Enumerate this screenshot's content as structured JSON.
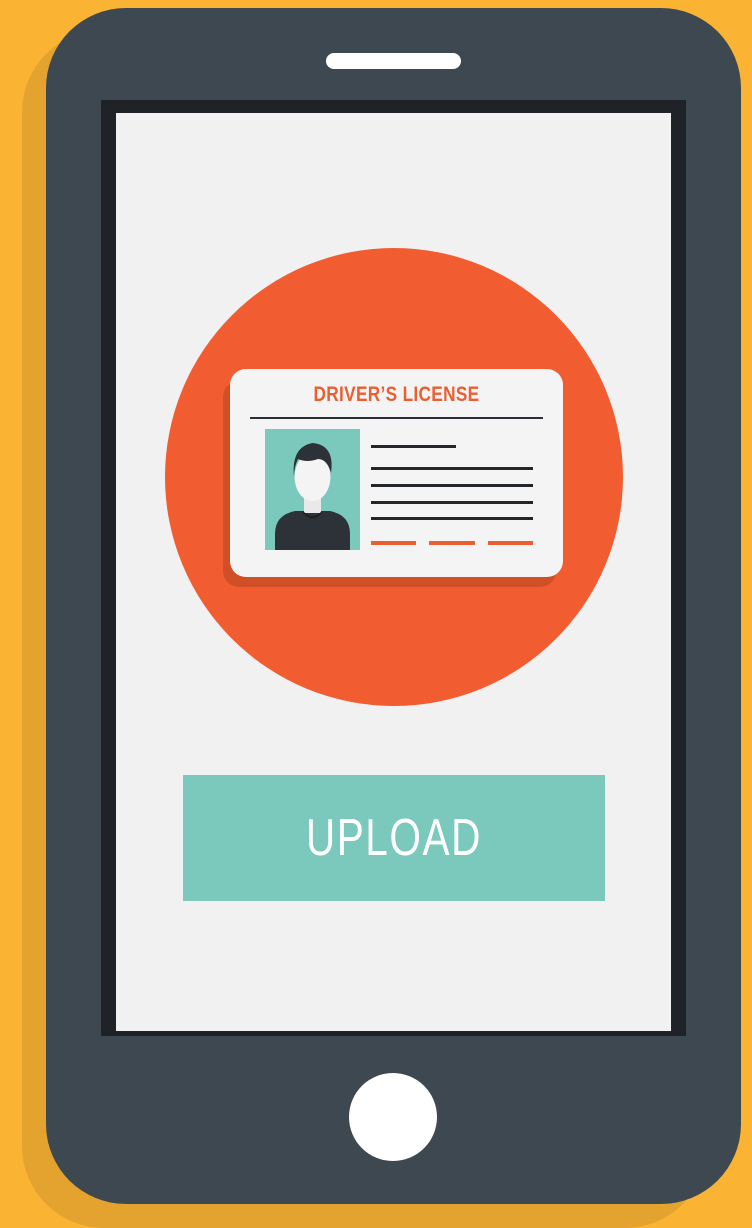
{
  "card": {
    "title": "DRIVER’S LICENSE",
    "photo_icon": "person-avatar-icon"
  },
  "upload": {
    "label": "UPLOAD"
  },
  "colors": {
    "background": "#fbb334",
    "phone_body": "#3e4851",
    "screen": "#f1f1f1",
    "badge": "#f15d31",
    "accent": "#e95f32",
    "button": "#7bc9bc"
  }
}
